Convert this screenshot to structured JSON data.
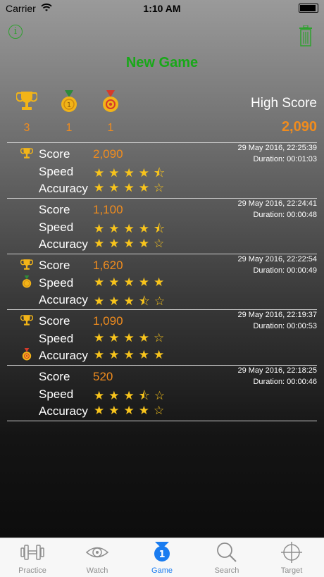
{
  "status": {
    "carrier": "Carrier",
    "time": "1:10 AM"
  },
  "header": {
    "title": "New Game"
  },
  "summary": {
    "trophies": "3",
    "gold": "1",
    "bullseye": "1",
    "high_score_label": "High Score",
    "high_score_value": "2,090"
  },
  "labels": {
    "score": "Score",
    "speed": "Speed",
    "accuracy": "Accuracy"
  },
  "records": [
    {
      "score": "2,090",
      "date": "29 May 2016, 22:25:39",
      "duration": "Duration: 00:01:03",
      "speed": "★★★★⯪",
      "accuracy": "★★★★☆"
    },
    {
      "score": "1,100",
      "date": "29 May 2016, 22:24:41",
      "duration": "Duration: 00:00:48",
      "speed": "★★★★⯪",
      "accuracy": "★★★★☆"
    },
    {
      "score": "1,620",
      "date": "29 May 2016, 22:22:54",
      "duration": "Duration: 00:00:49",
      "speed": "★★★★★",
      "accuracy": "★★★⯪☆"
    },
    {
      "score": "1,090",
      "date": "29 May 2016, 22:19:37",
      "duration": "Duration: 00:00:53",
      "speed": "★★★★☆",
      "accuracy": "★★★★★"
    },
    {
      "score": "520",
      "date": "29 May 2016, 22:18:25",
      "duration": "Duration: 00:00:46",
      "speed": "★★★⯪☆",
      "accuracy": "★★★★☆"
    }
  ],
  "tabs": [
    {
      "label": "Practice",
      "icon": "dumbbell-icon"
    },
    {
      "label": "Watch",
      "icon": "eye-icon"
    },
    {
      "label": "Game",
      "icon": "medal-icon"
    },
    {
      "label": "Search",
      "icon": "magnifier-icon"
    },
    {
      "label": "Target",
      "icon": "crosshair-icon"
    }
  ],
  "colors": {
    "accent": "#1a7cf0",
    "score": "#f08c1e",
    "title": "#18a818",
    "star": "#f8c41c"
  }
}
